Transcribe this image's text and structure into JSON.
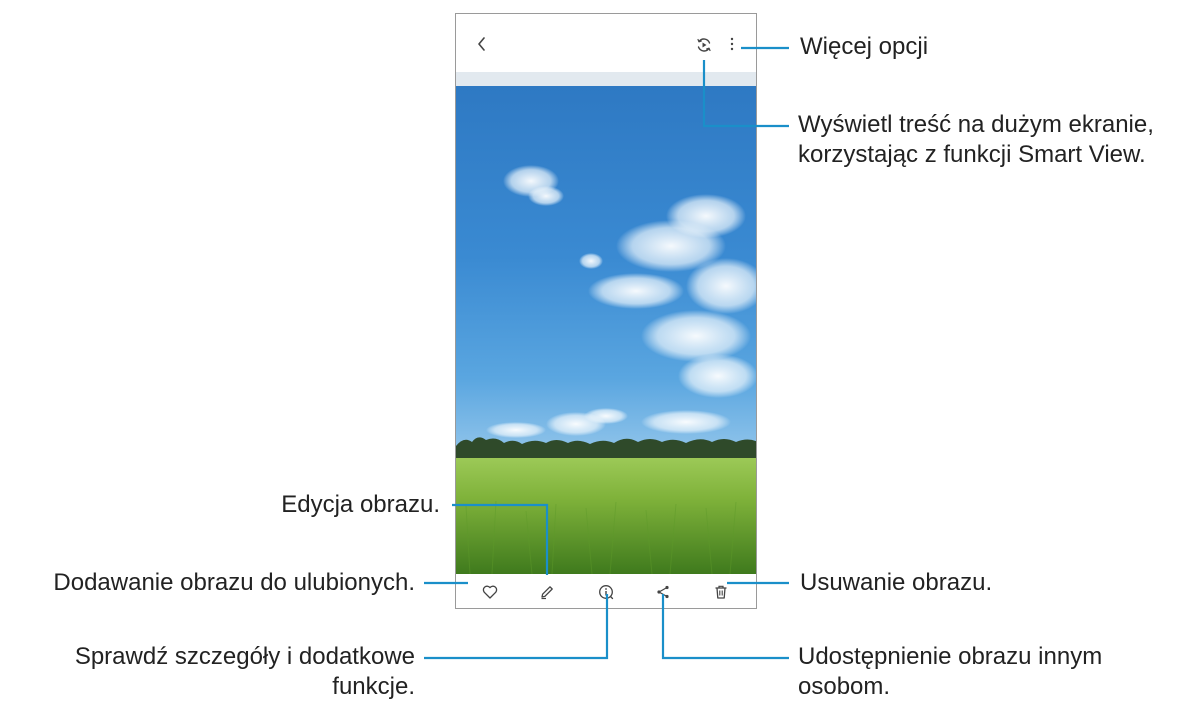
{
  "colors": {
    "callout_line": "#1a8fc9",
    "icon_stroke": "#444444",
    "sky_top": "#2e79c3",
    "field": "#7fb23a"
  },
  "topbar": {
    "back_icon": "chevron-left-icon",
    "smart_view_icon": "smart-view-icon",
    "more_icon": "more-vertical-icon"
  },
  "bottombar": {
    "favorite_icon": "heart-icon",
    "edit_icon": "pencil-icon",
    "details_icon": "info-icon",
    "share_icon": "share-icon",
    "delete_icon": "trash-icon"
  },
  "callouts": {
    "more_options": "Więcej opcji",
    "smart_view_line1": "Wyświetl treść na dużym ekranie,",
    "smart_view_line2": "korzystając z funkcji Smart View.",
    "edit": "Edycja obrazu.",
    "favorite": "Dodawanie obrazu do ulubionych.",
    "delete": "Usuwanie obrazu.",
    "details_line1": "Sprawdź szczegóły i dodatkowe",
    "details_line2": "funkcje.",
    "share_line1": "Udostępnienie obrazu innym",
    "share_line2": "osobom."
  }
}
